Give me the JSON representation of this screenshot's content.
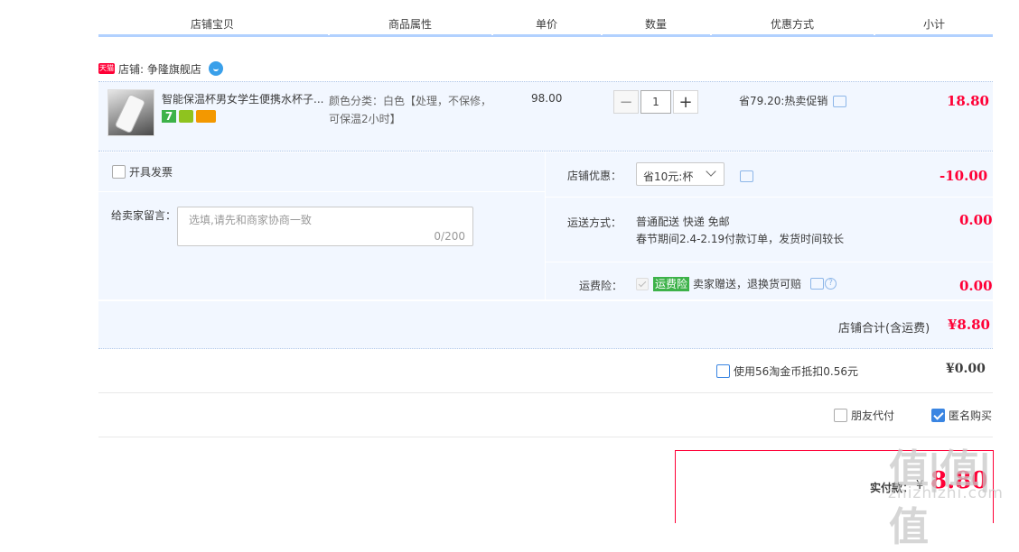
{
  "header": {
    "columns": [
      "店铺宝贝",
      "商品属性",
      "单价",
      "数量",
      "优惠方式",
      "小计"
    ]
  },
  "shop": {
    "badge": "天猫",
    "name": "店铺: 争隆旗舰店"
  },
  "item": {
    "title": "智能保温杯男女学生便携水杯子...",
    "badge_number": "7",
    "attr_line1": "颜色分类：白色【处理，不保修，",
    "attr_line2": "可保温2小时】",
    "unit_price": "98.00",
    "quantity": "1",
    "qty_minus": "−",
    "qty_plus": "+",
    "promo": "省79.20:热卖促销",
    "subtotal": "18.80"
  },
  "invoice": {
    "label": "开具发票"
  },
  "message": {
    "label": "给卖家留言：",
    "placeholder": "选填,请先和商家协商一致",
    "counter": "0/200"
  },
  "shop_discount": {
    "label": "店铺优惠：",
    "selected": "省10元:杯",
    "value": "-10.00"
  },
  "shipping": {
    "label": "运送方式：",
    "method": "普通配送 快递 免邮",
    "note": "春节期间2.4-2.19付款订单，发货时间较长",
    "value": "0.00"
  },
  "insurance": {
    "label": "运费险：",
    "badge": "运费险",
    "text": "卖家赠送，退换货可赔",
    "value": "0.00"
  },
  "shop_total": {
    "label": "店铺合计(含运费)",
    "value": "¥8.80"
  },
  "coins": {
    "label": "使用56淘金币抵扣0.56元",
    "value": "¥0.00"
  },
  "options": {
    "friend_pay": "朋友代付",
    "anonymous": "匿名购买"
  },
  "payment": {
    "label": "实付款：",
    "currency": "¥",
    "value": "8.80"
  },
  "watermark": {
    "logo": "值|值|值",
    "site": "zhizhizhi.com"
  },
  "colors": {
    "accent_red": "#ff0036",
    "header_line": "#b2d1ff",
    "panel_bg": "#f2f7ff",
    "checkbox_blue": "#3a85e2",
    "insurance_green": "#3db249"
  }
}
